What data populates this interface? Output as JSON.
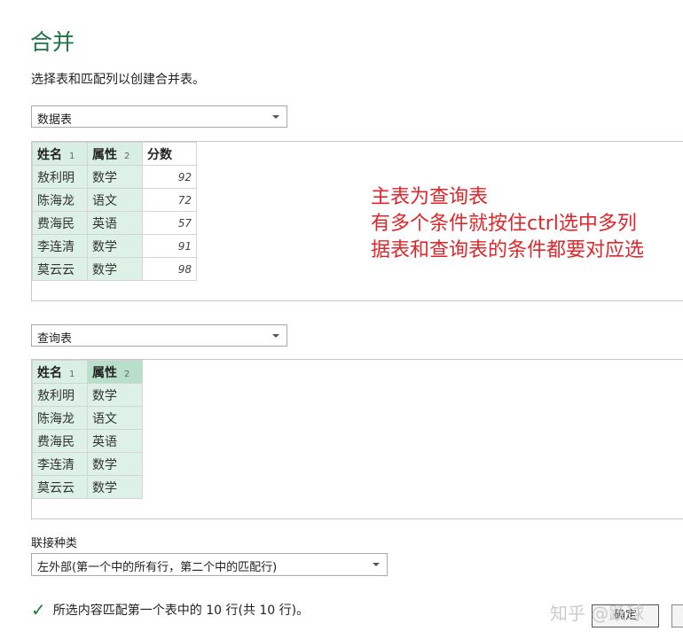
{
  "dialog": {
    "title": "合并",
    "subtitle": "选择表和匹配列以创建合并表。"
  },
  "table1": {
    "dropdown_value": "数据表",
    "headers": [
      {
        "label": "姓名",
        "num": "1"
      },
      {
        "label": "属性",
        "num": "2"
      },
      {
        "label": "分数",
        "num": ""
      }
    ],
    "rows": [
      [
        "敖利明",
        "数学",
        "92"
      ],
      [
        "陈海龙",
        "语文",
        "72"
      ],
      [
        "费海民",
        "英语",
        "57"
      ],
      [
        "李连清",
        "数学",
        "91"
      ],
      [
        "莫云云",
        "数学",
        "98"
      ]
    ]
  },
  "annotation": {
    "line1": "主表为查询表",
    "line2": "有多个条件就按住ctrl选中多列",
    "line3": "据表和查询表的条件都要对应选"
  },
  "table2": {
    "dropdown_value": "查询表",
    "headers": [
      {
        "label": "姓名",
        "num": "1"
      },
      {
        "label": "属性",
        "num": "2"
      }
    ],
    "rows": [
      [
        "敖利明",
        "数学"
      ],
      [
        "陈海龙",
        "语文"
      ],
      [
        "费海民",
        "英语"
      ],
      [
        "李连清",
        "数学"
      ],
      [
        "莫云云",
        "数学"
      ]
    ]
  },
  "join": {
    "label": "联接种类",
    "value": "左外部(第一个中的所有行，第二个中的匹配行)"
  },
  "status": {
    "icon": "checkmark-icon",
    "text": "所选内容匹配第一个表中的 10 行(共 10 行)。"
  },
  "buttons": {
    "ok_label": "确定"
  },
  "watermark": "知乎 @跃球",
  "colors": {
    "title_green": "#1e7145",
    "selected_column": "#ddf1e6",
    "annotation_red": "#e0262a"
  }
}
